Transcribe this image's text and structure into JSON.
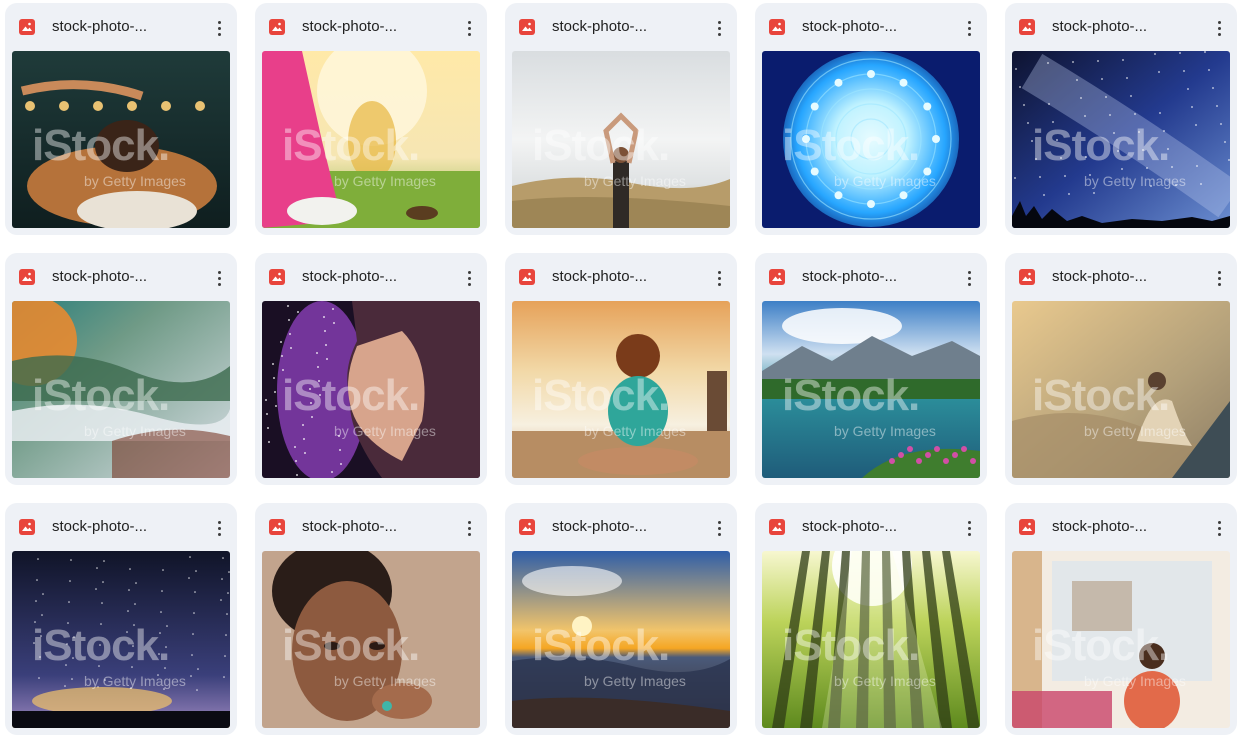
{
  "files": [
    {
      "name": "stock-photo-...",
      "icon": "image-file-icon",
      "scene": "spa-woman-candles",
      "colors": [
        "#1f3b3a",
        "#b5723a",
        "#3a2418"
      ]
    },
    {
      "name": "stock-photo-...",
      "icon": "image-file-icon",
      "scene": "meditation-meadow-sunlight",
      "colors": [
        "#f6e6b3",
        "#e83f8a",
        "#7fae3a"
      ]
    },
    {
      "name": "stock-photo-...",
      "icon": "image-file-icon",
      "scene": "woman-arms-raised-field",
      "colors": [
        "#d9dde0",
        "#f3f4f4",
        "#b79c6a"
      ]
    },
    {
      "name": "stock-photo-...",
      "icon": "image-file-icon",
      "scene": "blue-mandala",
      "colors": [
        "#0a1c6e",
        "#27a6ff",
        "#bff2ff"
      ]
    },
    {
      "name": "stock-photo-...",
      "icon": "image-file-icon",
      "scene": "milky-way-forest",
      "colors": [
        "#233a8e",
        "#6c8fd1",
        "#0e1330"
      ]
    },
    {
      "name": "stock-photo-...",
      "icon": "image-file-icon",
      "scene": "misty-hills-sunrise",
      "colors": [
        "#f08a2c",
        "#2a7f7c",
        "#d9dfe6"
      ]
    },
    {
      "name": "stock-photo-...",
      "icon": "image-file-icon",
      "scene": "woman-profile-purple-galaxy",
      "colors": [
        "#1a0f24",
        "#8a3fb8",
        "#d7a48c"
      ]
    },
    {
      "name": "stock-photo-...",
      "icon": "image-file-icon",
      "scene": "woman-writing-pier-sunset",
      "colors": [
        "#f2d9a8",
        "#f7f0e0",
        "#2fa69a"
      ]
    },
    {
      "name": "stock-photo-...",
      "icon": "image-file-icon",
      "scene": "mountain-lake-flowers",
      "colors": [
        "#3d7fc6",
        "#2b8d9a",
        "#2f6a2b"
      ]
    },
    {
      "name": "stock-photo-...",
      "icon": "image-file-icon",
      "scene": "woman-meditating-sea-vintage",
      "colors": [
        "#e9c98e",
        "#b3a07a",
        "#3e4d55"
      ]
    },
    {
      "name": "stock-photo-...",
      "icon": "image-file-icon",
      "scene": "starry-night-horizon",
      "colors": [
        "#101428",
        "#3a3f7a",
        "#f3c46a"
      ]
    },
    {
      "name": "stock-photo-...",
      "icon": "image-file-icon",
      "scene": "woman-portrait-curly-hair",
      "colors": [
        "#c2a48d",
        "#2a1d18",
        "#8d5a3f"
      ]
    },
    {
      "name": "stock-photo-...",
      "icon": "image-file-icon",
      "scene": "ocean-sunset",
      "colors": [
        "#2f5ea8",
        "#f5a623",
        "#3a2c28"
      ]
    },
    {
      "name": "stock-photo-...",
      "icon": "image-file-icon",
      "scene": "forest-sunbeams",
      "colors": [
        "#f7f7d0",
        "#5e8a1e",
        "#2e3b16"
      ]
    },
    {
      "name": "stock-photo-...",
      "icon": "image-file-icon",
      "scene": "woman-meditating-window",
      "colors": [
        "#f3ece2",
        "#d8b58c",
        "#e26a4a"
      ]
    }
  ],
  "watermark": {
    "brand": "iStock.",
    "byline": "by Getty Images"
  }
}
